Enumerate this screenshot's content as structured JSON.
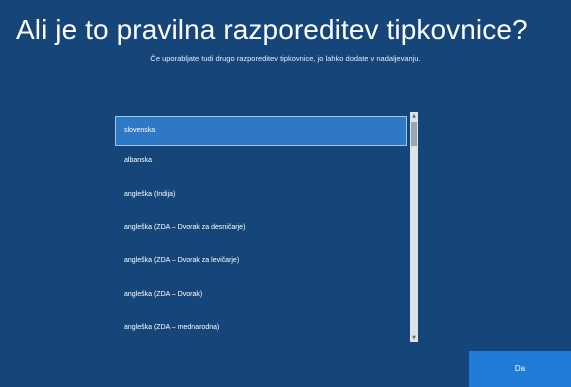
{
  "header": {
    "title": "Ali je to pravilna razporeditev tipkovnice?",
    "subtitle": "Če uporabljate tudi drugo razporeditev tipkovnice, jo lahko dodate v nadaljevanju."
  },
  "layout_list": {
    "selected": "slovenska",
    "items": [
      "slovenska",
      "albanska",
      "angleška (Indija)",
      "angleška (ZDA – Dvorak za desničarje)",
      "angleška (ZDA – Dvorak za levičarje)",
      "angleška (ZDA – Dvorak)",
      "angleška (ZDA – mednarodna)"
    ]
  },
  "footer": {
    "confirm_label": "Da"
  },
  "colors": {
    "background": "#16457a",
    "selected_item": "#2f78c6",
    "button": "#1f7bd6"
  },
  "icons": {
    "scroll_up": "scroll-up-arrow-icon",
    "scroll_down": "scroll-down-arrow-icon"
  }
}
